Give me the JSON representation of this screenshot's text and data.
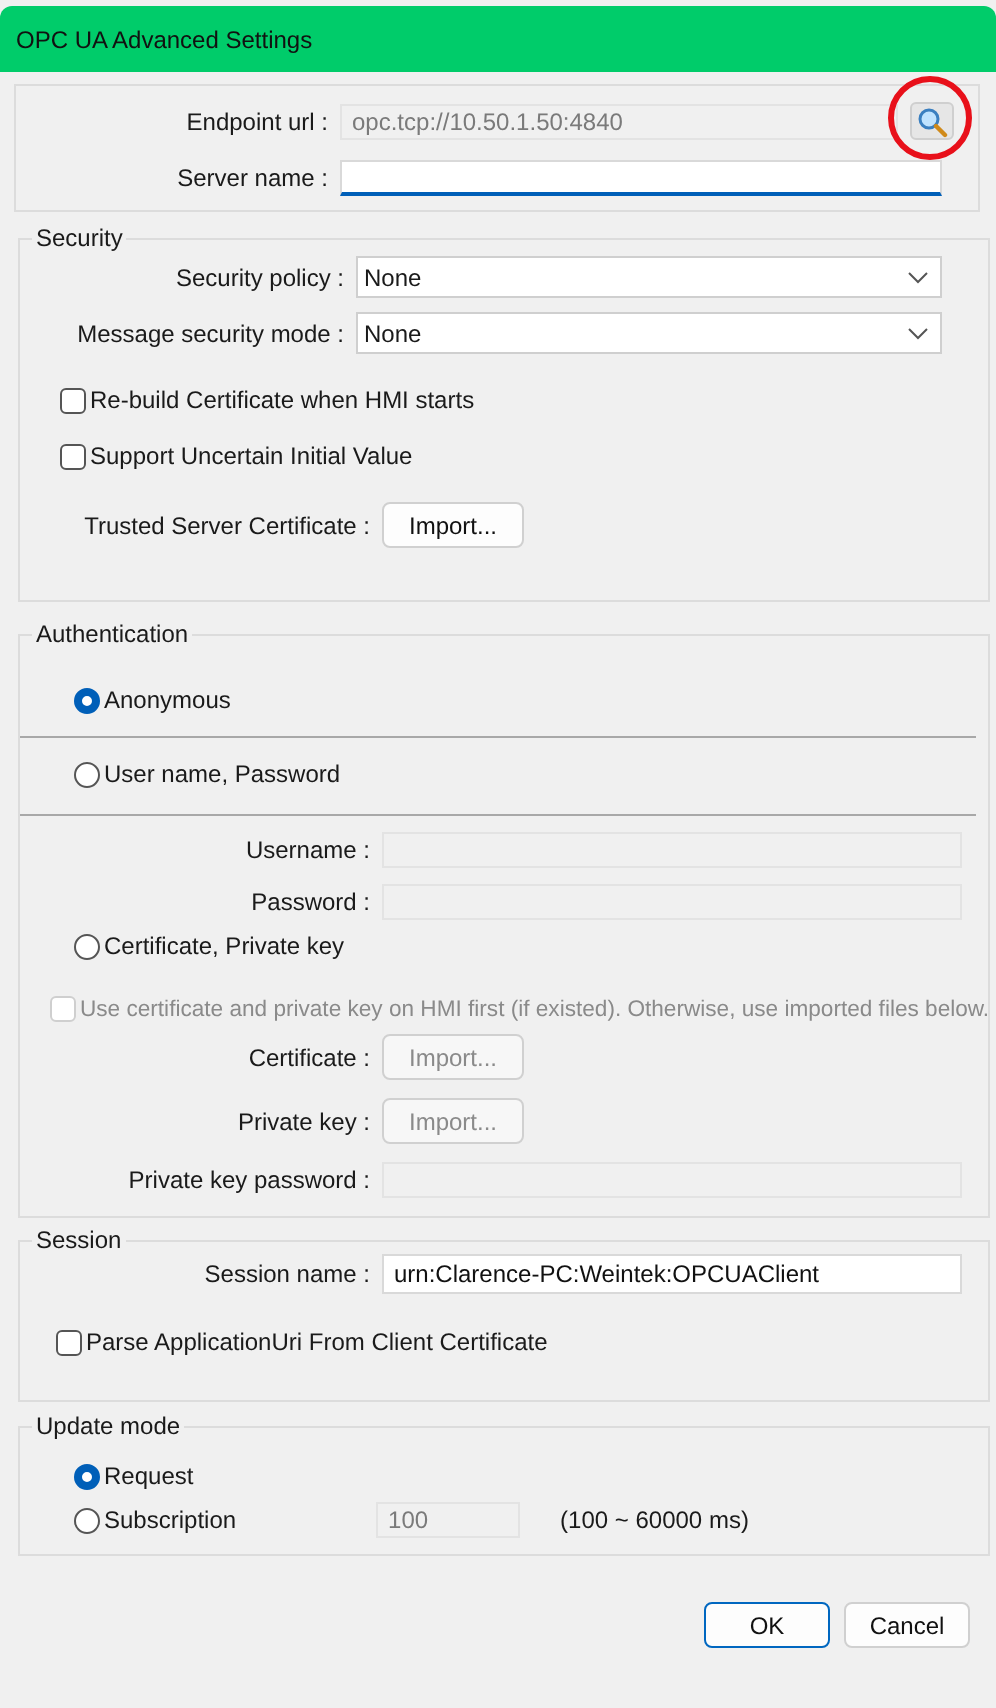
{
  "window": {
    "title": "OPC UA Advanced Settings"
  },
  "connection": {
    "endpoint": {
      "label": "Endpoint url :",
      "value": "opc.tcp://10.50.1.50:4840",
      "disabled": true
    },
    "server_name": {
      "label": "Server name :",
      "focused": true
    },
    "search_highlighted": true
  },
  "security": {
    "title": "Security",
    "selects": [
      {
        "label": "Security policy :",
        "value": "None"
      },
      {
        "label": "Message security mode :",
        "value": "None"
      }
    ],
    "checkboxes": [
      {
        "label": "Re-build Certificate when HMI starts",
        "checked": false
      },
      {
        "label": "Support Uncertain Initial Value",
        "checked": false
      }
    ],
    "trusted": {
      "label": "Trusted Server Certificate :",
      "button": "Import..."
    }
  },
  "authentication": {
    "title": "Authentication",
    "options": [
      {
        "label": "Anonymous",
        "selected": true
      },
      {
        "label": "User name, Password",
        "selected": false
      },
      {
        "label": "Certificate, Private key",
        "selected": false
      }
    ],
    "credentials": [
      {
        "label": "Username :",
        "disabled": true
      },
      {
        "label": "Password :",
        "disabled": true
      }
    ],
    "use_hmi_certificate": {
      "label": "Use certificate and private key on HMI first (if existed). Otherwise, use imported files below.",
      "checked": false,
      "disabled": true
    },
    "imports": [
      {
        "label": "Certificate :",
        "button": "Import...",
        "disabled": true
      },
      {
        "label": "Private key :",
        "button": "Import...",
        "disabled": true
      }
    ],
    "key_password": {
      "label": "Private key password :",
      "disabled": true
    }
  },
  "session": {
    "title": "Session",
    "name": {
      "label": "Session name :",
      "value": "urn:Clarence-PC:Weintek:OPCUAClient"
    },
    "parse_uri": {
      "label": "Parse ApplicationUri From Client Certificate",
      "checked": false
    }
  },
  "update_mode": {
    "title": "Update mode",
    "options": [
      {
        "label": "Request",
        "selected": true
      },
      {
        "label": "Subscription",
        "selected": false
      }
    ],
    "interval": {
      "value": "100",
      "disabled": true
    },
    "range": "(100 ~ 60000 ms)"
  },
  "buttons": [
    {
      "label": "OK",
      "default": true
    },
    {
      "label": "Cancel",
      "default": false
    }
  ]
}
